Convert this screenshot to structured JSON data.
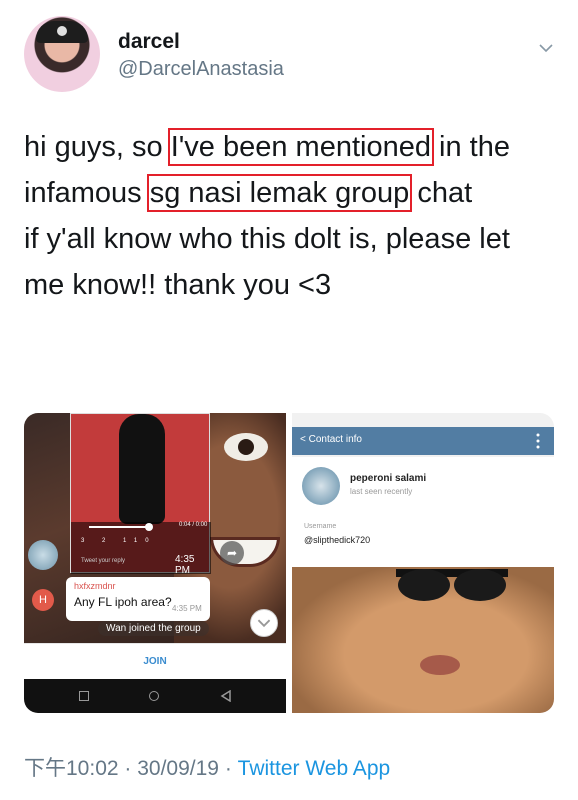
{
  "header": {
    "display_name": "darcel",
    "handle": "@DarcelAnastasia"
  },
  "tweet": {
    "line1_a": "hi guys, so ",
    "line1_hl": "I've been mentioned",
    "line1_b": " in the",
    "line2_a": "infamous ",
    "line2_hl": "sg nasi lemak group",
    "line2_b": " chat",
    "line3": "if y'all know who this dolt is, please let",
    "line4": "me know!! thank you <3"
  },
  "media": {
    "left": {
      "video_time": "0:04 / 0:00",
      "video_icons": "3  2  110",
      "reply_hint": "Tweet your reply",
      "video_timestamp": "4:35 PM",
      "sender": "hxfxzmdnr",
      "message": "Any FL ipoh area?",
      "message_time": "4:35 PM",
      "avatar_letter": "H",
      "system_message": "Wan joined the group",
      "join_label": "JOIN"
    },
    "right": {
      "header_back": "< Contact info",
      "contact_name": "peperoni salami",
      "last_seen": "last seen recently",
      "username_label": "Username",
      "username_value": "@slipthedick720"
    }
  },
  "meta": {
    "time": "下午10:02",
    "sep1": " · ",
    "date": "30/09/19",
    "sep2": " · ",
    "app": "Twitter Web App"
  },
  "colors": {
    "highlight_box": "#e3202a",
    "link": "#1b95e0",
    "secondary_text": "#657786"
  }
}
